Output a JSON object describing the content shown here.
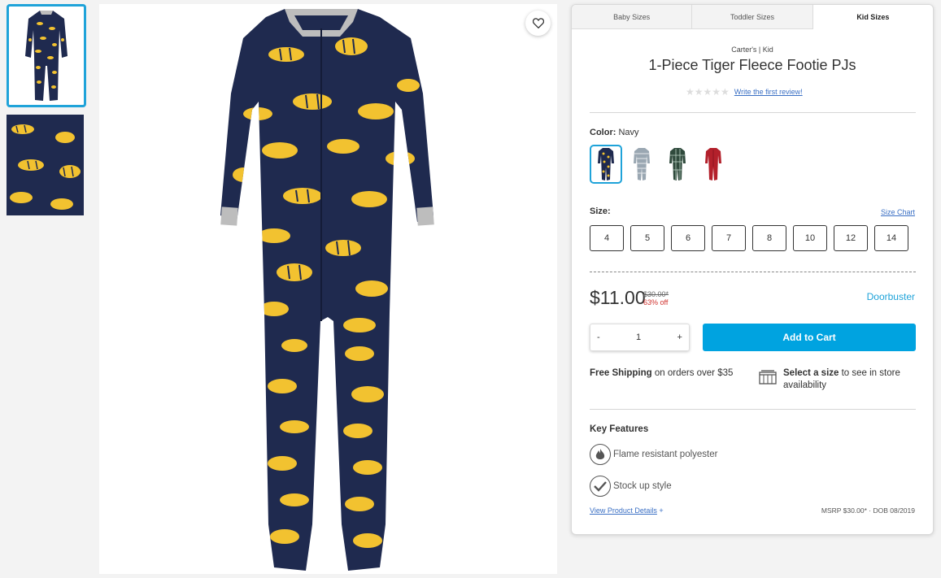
{
  "thumbnails": [
    {
      "name": "front-view"
    },
    {
      "name": "pattern-closeup"
    }
  ],
  "size_tabs": [
    "Baby Sizes",
    "Toddler Sizes",
    "Kid Sizes"
  ],
  "active_tab": "Kid Sizes",
  "product": {
    "brand": "Carter's | Kid",
    "title": "1-Piece Tiger Fleece Footie PJs",
    "review_link": "Write the first review!",
    "color_label": "Color:",
    "color_value": "Navy",
    "swatches": [
      {
        "name": "navy-tiger",
        "color": "#1f2a4f",
        "accent": "#f2c230"
      },
      {
        "name": "grey-stripe",
        "color": "#9aa7b2",
        "accent": "#e5e9ec"
      },
      {
        "name": "green-plaid",
        "color": "#2f4a3c",
        "accent": "#bcd2c4"
      },
      {
        "name": "red",
        "color": "#b3202b",
        "accent": "#8e1520"
      }
    ],
    "size_label": "Size:",
    "size_chart": "Size Chart",
    "sizes": [
      "4",
      "5",
      "6",
      "7",
      "8",
      "10",
      "12",
      "14"
    ],
    "price": "$11.00",
    "original_price": "$30.00*",
    "discount": "63% off",
    "promo": "Doorbuster",
    "qty_minus": "-",
    "qty_value": "1",
    "qty_plus": "+",
    "add_to_cart": "Add to Cart",
    "shipping_bold": "Free Shipping",
    "shipping_rest": " on orders over $35",
    "store_bold": "Select a size",
    "store_rest": " to see in store availability",
    "key_features_title": "Key Features",
    "features": [
      "Flame resistant polyester",
      "Stock up style"
    ],
    "details_link": "View Product Details",
    "details_plus": "+",
    "msrp": "MSRP $30.00* · DOB 08/2019"
  },
  "colors": {
    "accent": "#00a3e0",
    "link": "#3a6fc4",
    "sale": "#d0312d",
    "pajama": "#1f2a4f",
    "tiger": "#f2c230"
  }
}
